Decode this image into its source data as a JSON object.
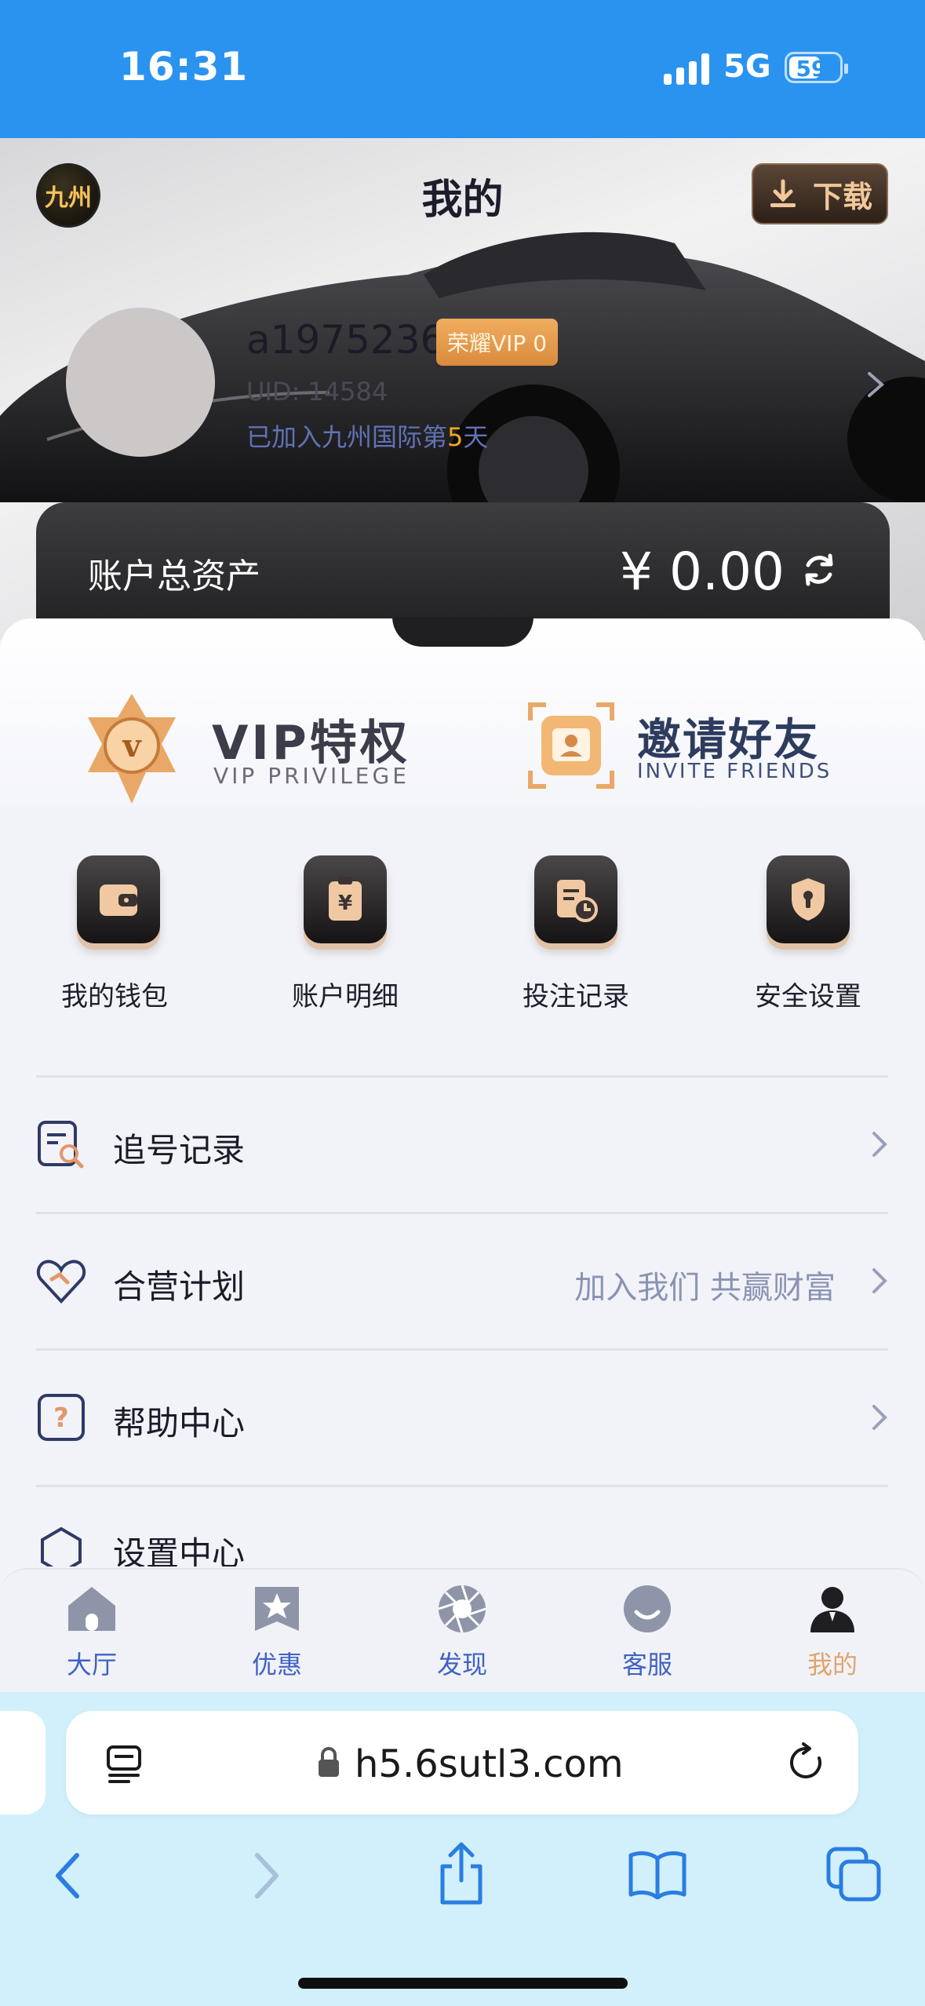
{
  "status": {
    "time": "16:31",
    "network": "5G",
    "battery": "59"
  },
  "header": {
    "title": "我的",
    "logo_text": "九州",
    "download_label": "下载"
  },
  "profile": {
    "username": "a1975236",
    "vip_badge": "荣耀VIP 0",
    "uid": "UID: 14584",
    "joined_prefix": "已加入九州国际第",
    "joined_days": "5",
    "joined_suffix": "天"
  },
  "assets": {
    "label": "账户总资产",
    "value": "¥ 0.00"
  },
  "promos": {
    "vip": {
      "title": "VIP特权",
      "subtitle": "VIP PRIVILEGE"
    },
    "invite": {
      "title": "邀请好友",
      "subtitle": "INVITE FRIENDS"
    }
  },
  "quick_actions": [
    {
      "label": "我的钱包",
      "icon": "wallet-icon"
    },
    {
      "label": "账户明细",
      "icon": "yen-clipboard-icon"
    },
    {
      "label": "投注记录",
      "icon": "bet-record-icon"
    },
    {
      "label": "安全设置",
      "icon": "shield-lock-icon"
    }
  ],
  "menu": [
    {
      "label": "追号记录",
      "extra": "",
      "icon": "search-doc-icon"
    },
    {
      "label": "合营计划",
      "extra": "加入我们 共赢财富",
      "icon": "handshake-heart-icon"
    },
    {
      "label": "帮助中心",
      "extra": "",
      "icon": "help-icon"
    },
    {
      "label": "设置中心",
      "extra": "",
      "icon": "settings-icon"
    }
  ],
  "tabs": [
    {
      "label": "大厅",
      "icon": "home-icon"
    },
    {
      "label": "优惠",
      "icon": "star-tag-icon"
    },
    {
      "label": "发现",
      "icon": "aperture-icon"
    },
    {
      "label": "客服",
      "icon": "smile-icon"
    },
    {
      "label": "我的",
      "icon": "user-icon",
      "active": true
    }
  ],
  "browser": {
    "url": "h5.6sutl3.com"
  },
  "colors": {
    "accent": "#2a93f0",
    "gold": "#e0a46c",
    "tab_blue": "#3f62c4"
  }
}
